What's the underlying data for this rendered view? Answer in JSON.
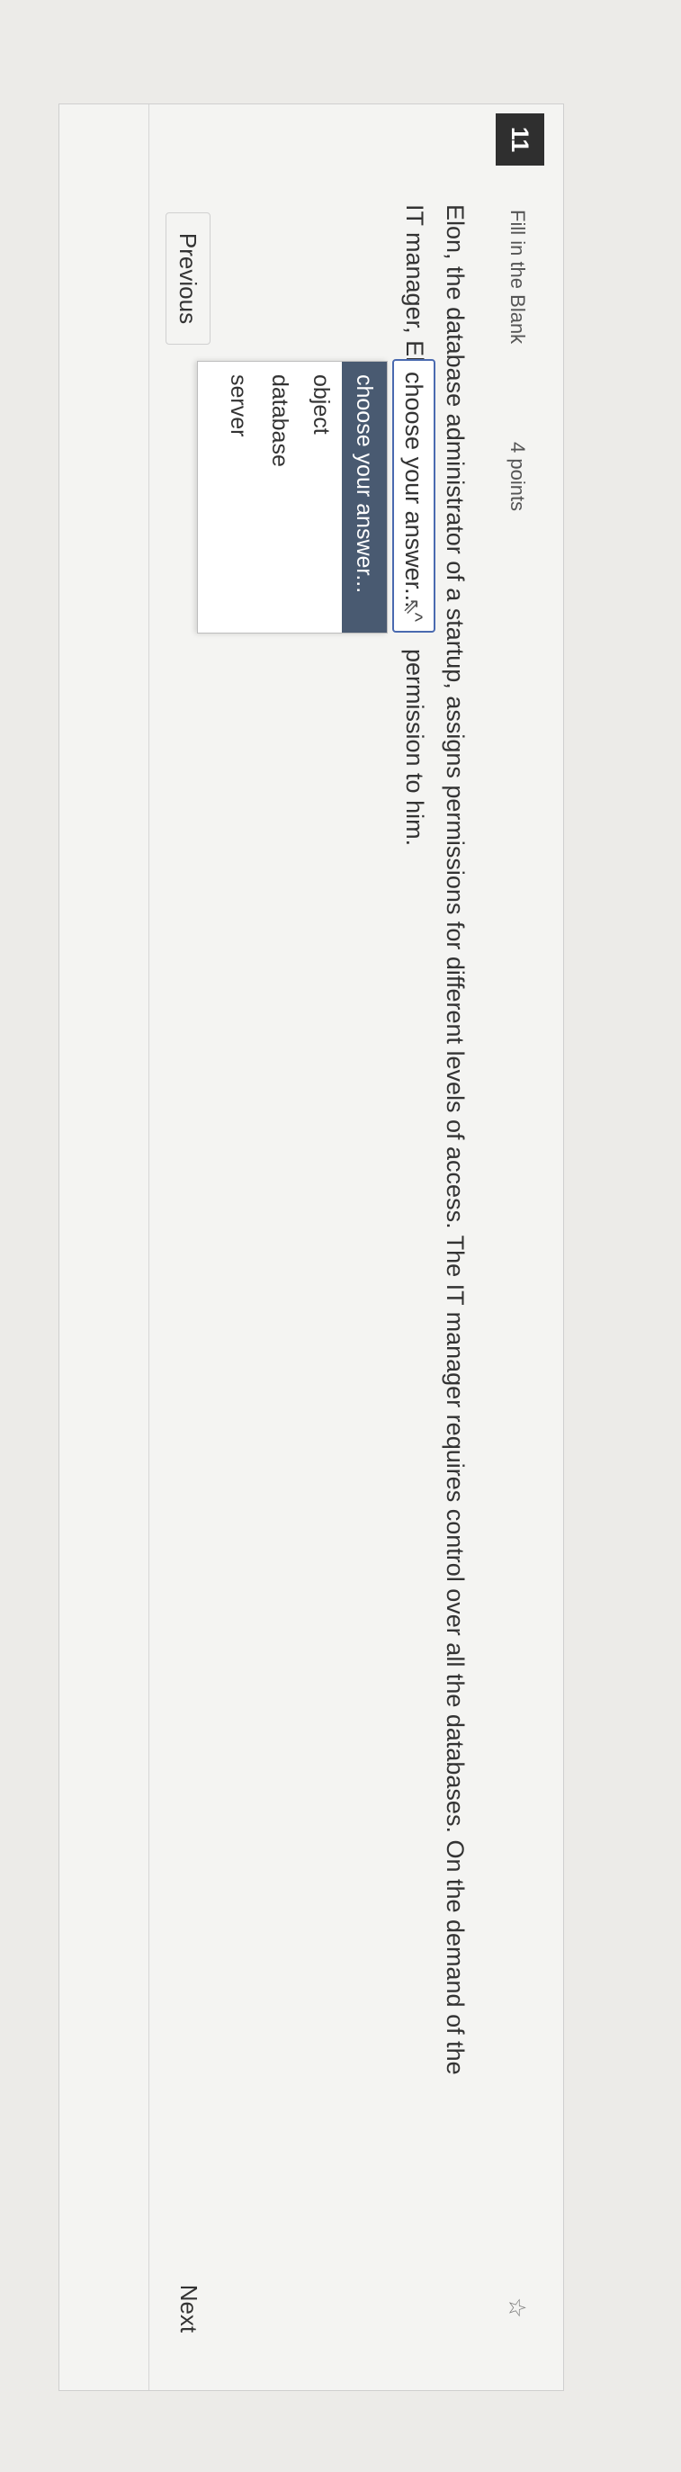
{
  "question": {
    "number": "11",
    "type": "Fill in the Blank",
    "points": "4 points",
    "line1": "Elon, the database administrator of a startup, assigns permissions for different levels of access. The IT manager requires control over all the databases. On the demand of the",
    "line2_before": "IT manager, Elon gives",
    "line2_after": "permission to him."
  },
  "select": {
    "value": "choose your answer...",
    "caret": "^",
    "options": [
      "choose your answer...",
      "object",
      "database",
      "server"
    ]
  },
  "nav": {
    "previous": "Previous",
    "next": "Next"
  },
  "icons": {
    "pin": "☆",
    "cursor": "⇖"
  },
  "colors": {
    "selected_option_bg": "#495a71",
    "select_border": "#4a6ab0"
  }
}
